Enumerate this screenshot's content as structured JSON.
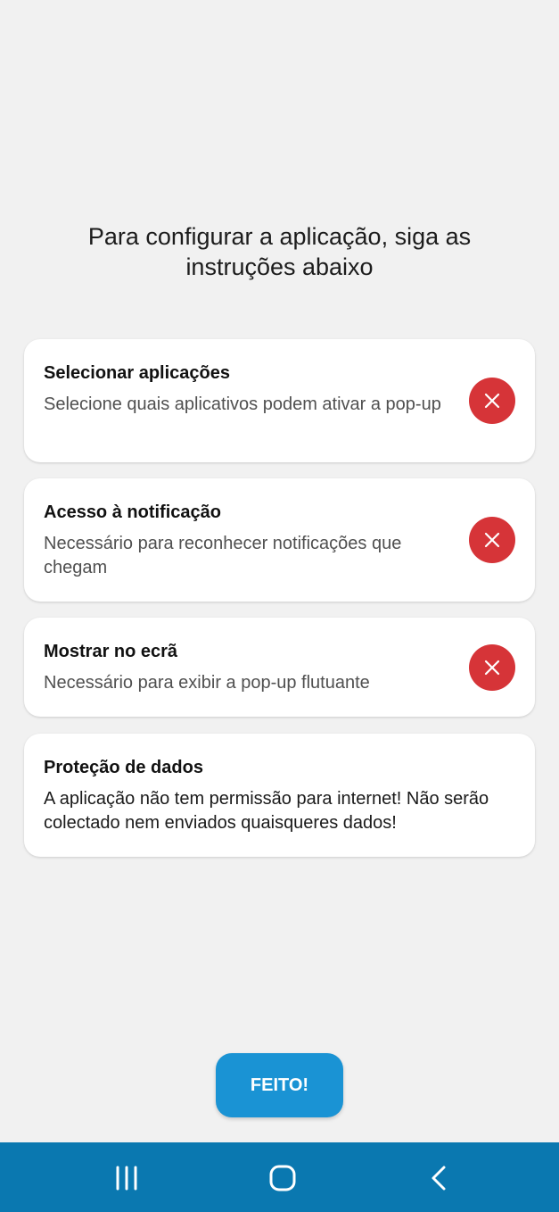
{
  "heading": "Para configurar a aplicação, siga as instruções abaixo",
  "cards": [
    {
      "title": "Selecionar aplicações",
      "description": "Selecione quais aplicativos podem ativar a pop-up",
      "status_icon": "close-icon",
      "status_color": "#d63438"
    },
    {
      "title": "Acesso à notificação",
      "description": "Necessário para reconhecer notificações que chegam",
      "status_icon": "close-icon",
      "status_color": "#d63438"
    },
    {
      "title": "Mostrar no ecrã",
      "description": "Necessário para exibir a pop-up flutuante",
      "status_icon": "close-icon",
      "status_color": "#d63438"
    },
    {
      "title": "Proteção de dados",
      "description": "A aplicação não tem permissão para internet! Não serão colectado nem enviados quaisqueres dados!"
    }
  ],
  "done_button": {
    "label": "FEITO!",
    "color": "#1a93d4"
  },
  "navbar": {
    "color": "#0a78b0",
    "icons": [
      "recent-apps-icon",
      "home-icon",
      "back-icon"
    ]
  }
}
